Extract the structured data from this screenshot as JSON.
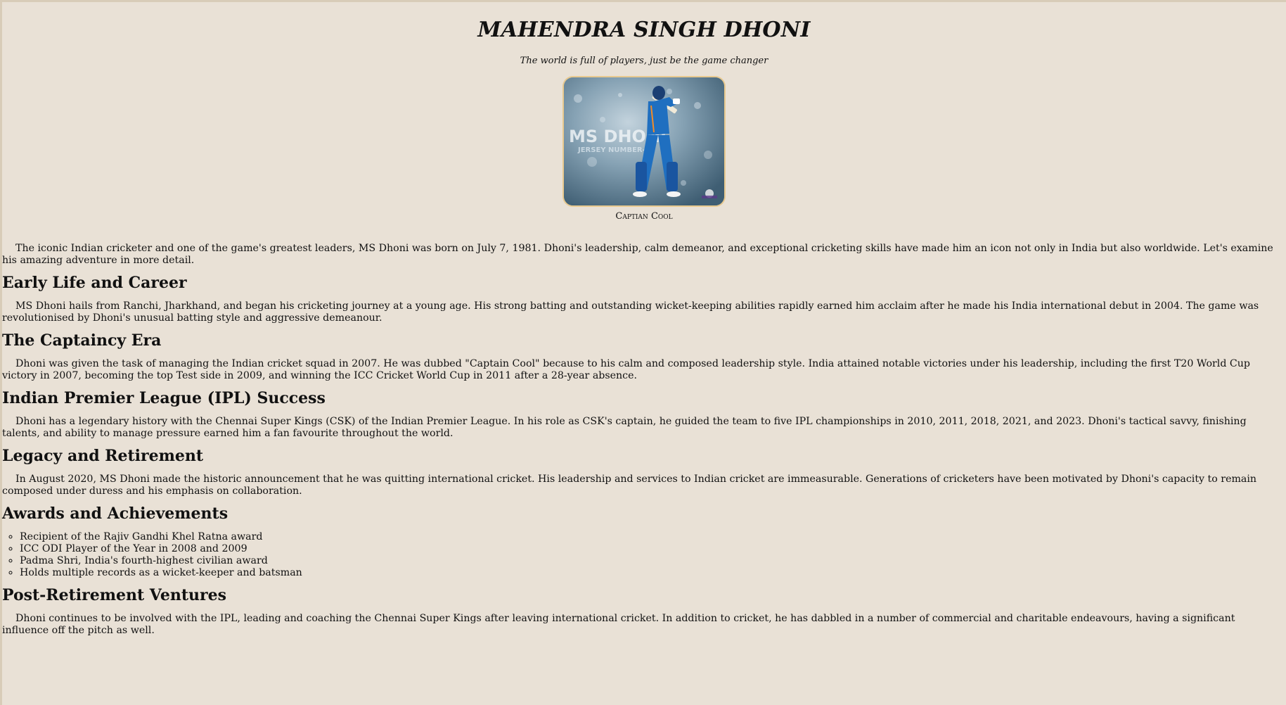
{
  "header": {
    "title": "MAHENDRA SINGH DHONI",
    "subtitle": "The world is full of players, just be the game changer"
  },
  "figure": {
    "image_text_main": "MS DHONI",
    "image_text_sub": "JERSEY NUMBER-7",
    "caption": "Captian Cool"
  },
  "intro": "The iconic Indian cricketer and one of the game's greatest leaders, MS Dhoni was born on July 7, 1981. Dhoni's leadership, calm demeanor, and exceptional cricketing skills have made him an icon not only in India but also worldwide. Let's examine his amazing adventure in more detail.",
  "sections": [
    {
      "heading": "Early Life and Career",
      "text": "MS Dhoni hails from Ranchi, Jharkhand, and began his cricketing journey at a young age. His strong batting and outstanding wicket-keeping abilities rapidly earned him acclaim after he made his India international debut in 2004. The game was revolutionised by Dhoni's unusual batting style and aggressive demeanour."
    },
    {
      "heading": "The Captaincy Era",
      "text": "Dhoni was given the task of managing the Indian cricket squad in 2007. He was dubbed \"Captain Cool\" because to his calm and composed leadership style. India attained notable victories under his leadership, including the first T20 World Cup victory in 2007, becoming the top Test side in 2009, and winning the ICC Cricket World Cup in 2011 after a 28-year absence."
    },
    {
      "heading": "Indian Premier League (IPL) Success",
      "text": "Dhoni has a legendary history with the Chennai Super Kings (CSK) of the Indian Premier League. In his role as CSK's captain, he guided the team to five IPL championships in 2010, 2011, 2018, 2021, and 2023. Dhoni's tactical savvy, finishing talents, and ability to manage pressure earned him a fan favourite throughout the world."
    },
    {
      "heading": "Legacy and Retirement",
      "text": "In August 2020, MS Dhoni made the historic announcement that he was quitting international cricket. His leadership and services to Indian cricket are immeasurable. Generations of cricketers have been motivated by Dhoni's capacity to remain composed under duress and his emphasis on collaboration."
    },
    {
      "heading": "Awards and Achievements",
      "items": [
        "Recipient of the Rajiv Gandhi Khel Ratna award",
        "ICC ODI Player of the Year in 2008 and 2009",
        "Padma Shri, India's fourth-highest civilian award",
        "Holds multiple records as a wicket-keeper and batsman"
      ]
    },
    {
      "heading": "Post-Retirement Ventures",
      "text": "Dhoni continues to be involved with the IPL, leading and coaching the Chennai Super Kings after leaving international cricket. In addition to cricket, he has dabbled in a number of commercial and charitable endeavours, having a significant influence off the pitch as well."
    }
  ],
  "colors": {
    "background": "#e9e1d6",
    "image_border": "#e8c98f",
    "jersey_blue": "#1f6fc0"
  }
}
